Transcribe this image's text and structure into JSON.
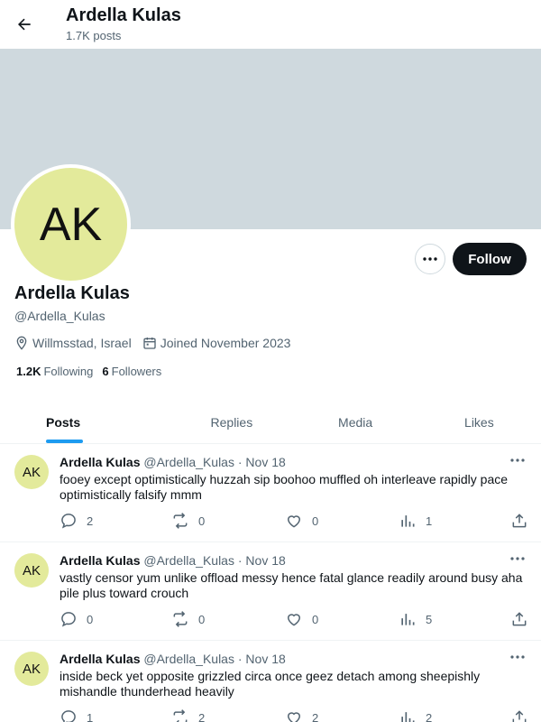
{
  "header": {
    "name": "Ardella Kulas",
    "post_count": "1.7K posts"
  },
  "profile": {
    "avatar_initials": "AK",
    "name": "Ardella Kulas",
    "handle": "@Ardella_Kulas",
    "location": "Willmsstad, Israel",
    "joined": "Joined November 2023",
    "following_count": "1.2K",
    "following_label": "Following",
    "followers_count": "6",
    "followers_label": "Followers",
    "follow_label": "Follow",
    "more_label": "···"
  },
  "tabs": [
    {
      "label": "Posts",
      "active": true
    },
    {
      "label": "Replies",
      "active": false
    },
    {
      "label": "Media",
      "active": false
    },
    {
      "label": "Likes",
      "active": false
    }
  ],
  "posts": [
    {
      "avatar": "AK",
      "author": "Ardella Kulas",
      "handle": "@Ardella_Kulas",
      "date": "· Nov 18",
      "more": "···",
      "text": "fooey except optimistically huzzah sip boohoo muffled oh interleave rapidly pace optimistically falsify mmm",
      "replies": "2",
      "reposts": "0",
      "likes": "0",
      "views": "1"
    },
    {
      "avatar": "AK",
      "author": "Ardella Kulas",
      "handle": "@Ardella_Kulas",
      "date": "· Nov 18",
      "more": "···",
      "text": "vastly censor yum unlike offload messy hence fatal glance readily around busy aha pile plus toward crouch",
      "replies": "0",
      "reposts": "0",
      "likes": "0",
      "views": "5"
    },
    {
      "avatar": "AK",
      "author": "Ardella Kulas",
      "handle": "@Ardella_Kulas",
      "date": "· Nov 18",
      "more": "···",
      "text": "inside beck yet opposite grizzled circa once geez detach among sheepishly mishandle thunderhead heavily",
      "replies": "1",
      "reposts": "2",
      "likes": "2",
      "views": "2"
    }
  ],
  "icons": {
    "back": "arrow-left-icon",
    "location": "location-pin-icon",
    "calendar": "calendar-icon",
    "reply": "reply-bubble-icon",
    "repost": "repost-icon",
    "like": "heart-icon",
    "views": "views-bar-icon",
    "share": "share-icon"
  },
  "colors": {
    "accent": "#1d9bf0",
    "banner": "#cfd9de",
    "avatar_bg": "#e3ea9b",
    "follow_bg": "#0f1419"
  }
}
